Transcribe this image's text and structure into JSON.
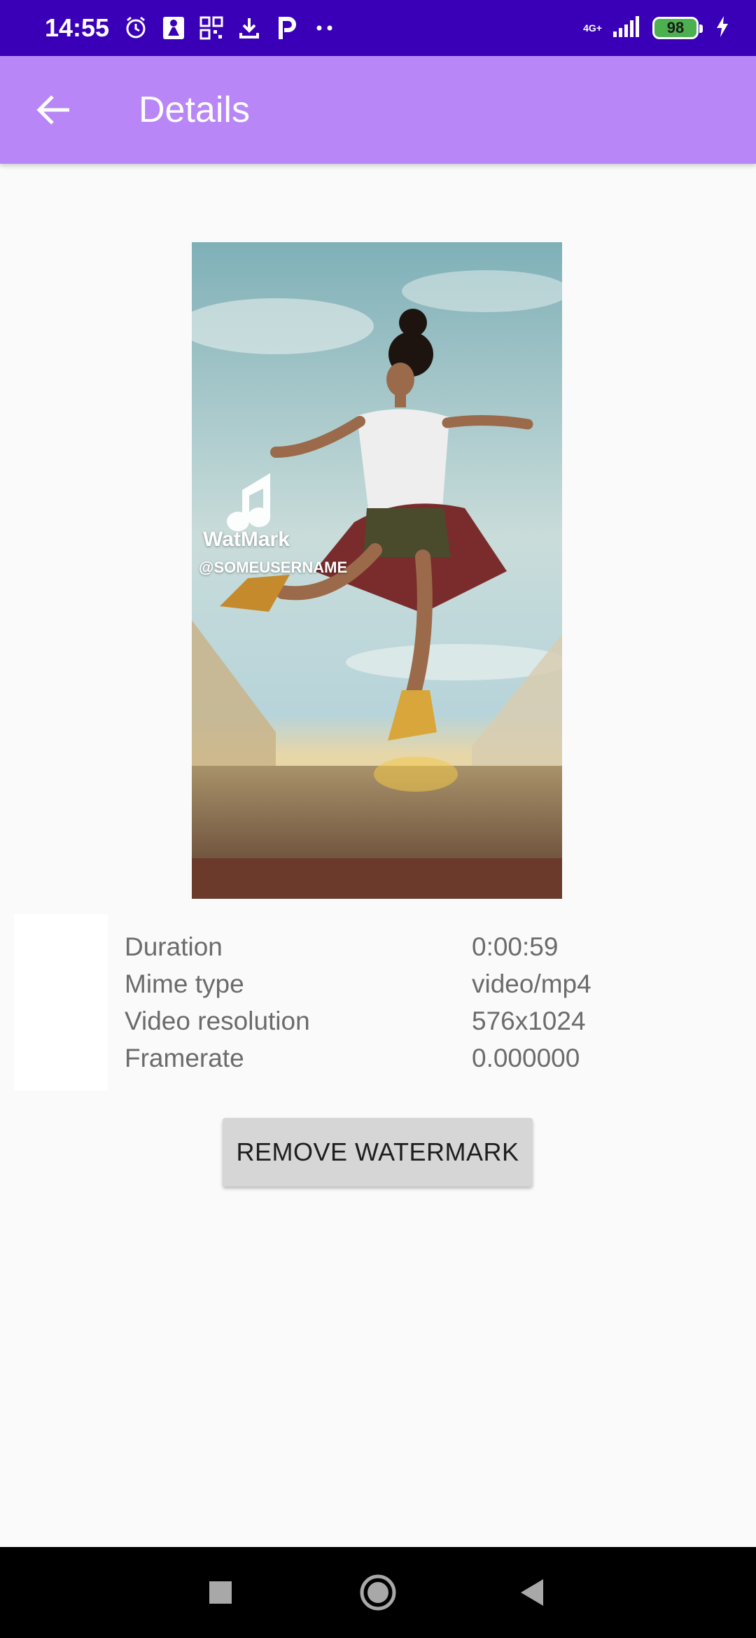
{
  "status_bar": {
    "time": "14:55",
    "network": "4G+",
    "battery": "98",
    "icons": [
      "alarm-icon",
      "person-icon",
      "grid-icon",
      "download-icon",
      "p-icon",
      "more-dots-icon",
      "signal-icon",
      "charging-icon"
    ]
  },
  "app_bar": {
    "title": "Details",
    "back_icon": "arrow-back-icon"
  },
  "thumbnail": {
    "watermark_label": "WatMark",
    "watermark_user": "@SOMEUSERNAME",
    "icon": "music-note-icon"
  },
  "details": {
    "rows": [
      {
        "label": "Duration",
        "value": "0:00:59"
      },
      {
        "label": "Mime type",
        "value": "video/mp4"
      },
      {
        "label": "Video resolution",
        "value": "576x1024"
      },
      {
        "label": "Framerate",
        "value": "0.000000"
      }
    ]
  },
  "actions": {
    "remove_label": "REMOVE WATERMARK"
  },
  "nav_bar": {
    "icons": [
      "recents-square-icon",
      "home-circle-icon",
      "back-triangle-icon"
    ]
  },
  "colors": {
    "status_bar": "#3a00b8",
    "app_bar": "#b886f6",
    "background": "#fafafa",
    "button": "#d6d6d6"
  }
}
